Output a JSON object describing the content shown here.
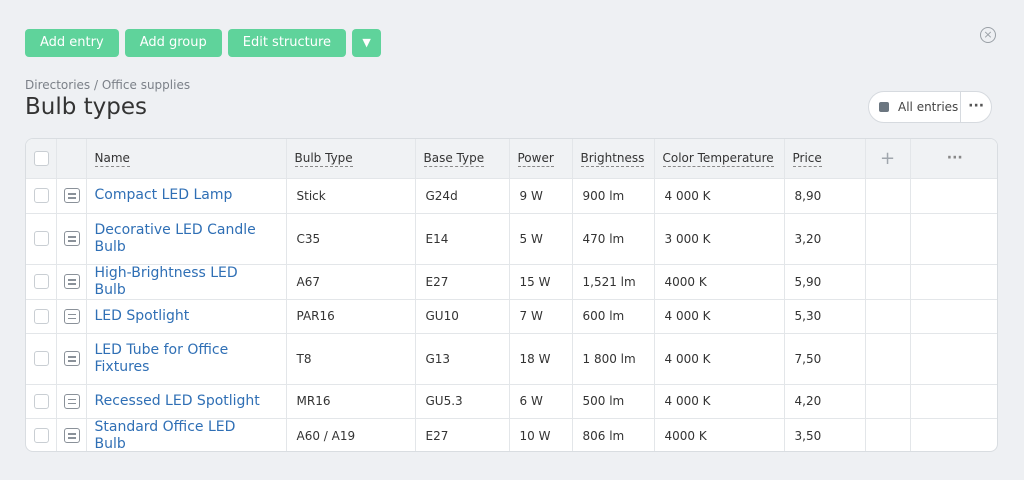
{
  "toolbar": {
    "add_entry": "Add entry",
    "add_group": "Add group",
    "edit_structure": "Edit structure",
    "dropdown": "▼"
  },
  "close": "×",
  "breadcrumb": "Directories / Office supplies",
  "title": "Bulb types",
  "filter": {
    "label": "All entries",
    "more": "···"
  },
  "table": {
    "add_column": "+",
    "more_columns": "···",
    "columns": [
      "Name",
      "Bulb Type",
      "Base Type",
      "Power",
      "Brightness",
      "Color Temperature",
      "Price"
    ],
    "rows": [
      {
        "name": "Compact LED Lamp",
        "bulb": "Stick",
        "base": "G24d",
        "power": "9 W",
        "brightness": "900 lm",
        "temp": "4 000 K",
        "price": "8,90"
      },
      {
        "name": "Decorative LED Candle Bulb",
        "bulb": "C35",
        "base": "E14",
        "power": "5 W",
        "brightness": "470 lm",
        "temp": "3 000 K",
        "price": "3,20"
      },
      {
        "name": "High-Brightness LED Bulb",
        "bulb": "A67",
        "base": "E27",
        "power": "15 W",
        "brightness": "1,521 lm",
        "temp": "4000 K",
        "price": "5,90"
      },
      {
        "name": "LED Spotlight",
        "bulb": "PAR16",
        "base": "GU10",
        "power": "7 W",
        "brightness": "600 lm",
        "temp": "4 000 K",
        "price": "5,30"
      },
      {
        "name": "LED Tube for Office Fixtures",
        "bulb": "T8",
        "base": "G13",
        "power": "18 W",
        "brightness": "1 800 lm",
        "temp": "4 000 K",
        "price": "7,50"
      },
      {
        "name": "Recessed LED Spotlight",
        "bulb": "MR16",
        "base": "GU5.3",
        "power": "6 W",
        "brightness": "500 lm",
        "temp": "4 000 K",
        "price": "4,20"
      },
      {
        "name": "Standard Office LED Bulb",
        "bulb": "A60 / A19",
        "base": "E27",
        "power": "10 W",
        "brightness": "806 lm",
        "temp": "4000 K",
        "price": "3,50"
      }
    ]
  },
  "colors": {
    "accent": "#5fd39b",
    "link": "#2f6fb5",
    "background": "#eef0f3"
  }
}
